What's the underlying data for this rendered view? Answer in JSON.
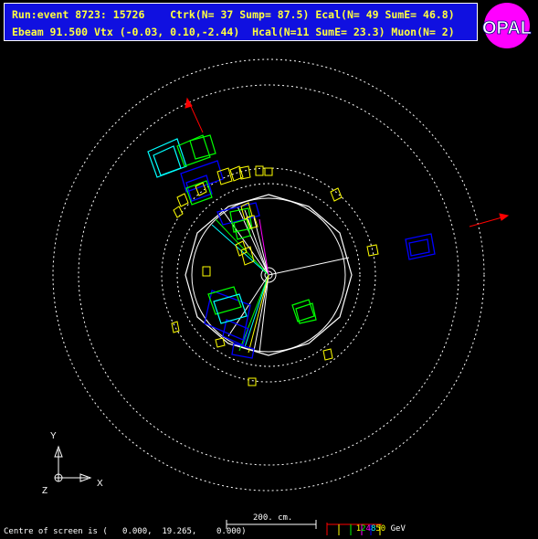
{
  "header": {
    "line1": "Run:event 8723: 15726    Ctrk(N= 37 Sump= 87.5) Ecal(N= 49 SumE= 46.8)",
    "line2": "Ebeam 91.500 Vtx (-0.03, 0.10,-2.44)  Hcal(N=11 SumE= 23.3) Muon(N= 2)"
  },
  "logo": {
    "text": "OPAL",
    "bg": "#ff00ff"
  },
  "axes": {
    "y": "Y",
    "x": "X",
    "z": "Z"
  },
  "scale_bar": {
    "label": "200. cm."
  },
  "screen_centre": {
    "text": "Centre of screen is (   0.000,  19.265,    0.000)"
  },
  "energy_legend": {
    "values": [
      "1",
      "2",
      "4",
      "8",
      "50"
    ],
    "unit": "GeV",
    "colors": [
      "#ffff00",
      "#00ff00",
      "#ff00ff",
      "#00ffff",
      "#ffff00"
    ]
  },
  "colors": {
    "background": "#000000",
    "header_bg": "#1010e0",
    "header_text": "#ffff40",
    "ecal": "#0000ff",
    "hcal": "#ffff00",
    "tracks": "#ffffff",
    "muon": "#ff0000"
  }
}
